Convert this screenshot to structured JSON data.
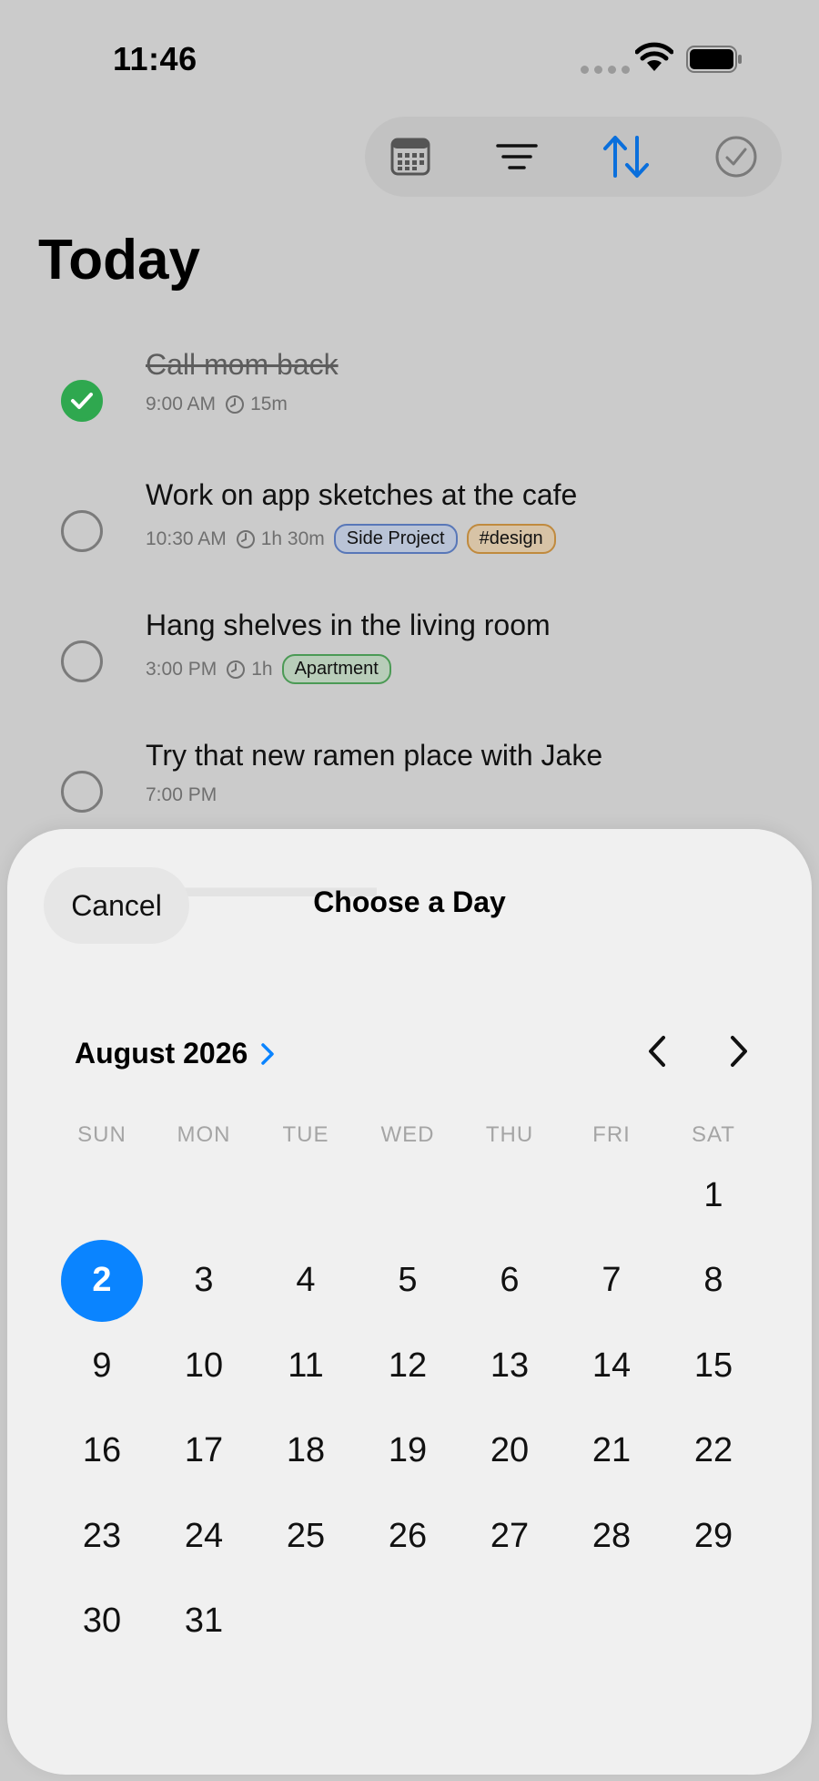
{
  "status_bar": {
    "time": "11:46"
  },
  "toolbar": {
    "buttons": [
      "calendar-icon",
      "filter-icon",
      "sort-icon",
      "checkmark-circle-icon"
    ],
    "accent": "#0a6fdc"
  },
  "page": {
    "title": "Today"
  },
  "tasks": [
    {
      "title": "Call mom back",
      "time": "9:00 AM",
      "duration": "15m",
      "completed": true,
      "tags": []
    },
    {
      "title": "Work on app sketches at the cafe",
      "time": "10:30 AM",
      "duration": "1h 30m",
      "completed": false,
      "tags": [
        {
          "label": "Side Project",
          "color": "blue"
        },
        {
          "label": "#design",
          "color": "orange"
        }
      ]
    },
    {
      "title": "Hang shelves in the living room",
      "time": "3:00 PM",
      "duration": "1h",
      "completed": false,
      "tags": [
        {
          "label": "Apartment",
          "color": "green"
        }
      ]
    },
    {
      "title": "Try that new ramen place with Jake",
      "time": "7:00 PM",
      "duration": "",
      "completed": false,
      "tags": []
    }
  ],
  "sheet": {
    "cancel_label": "Cancel",
    "title": "Choose a Day",
    "month_label": "August 2026",
    "weekdays": [
      "SUN",
      "MON",
      "TUE",
      "WED",
      "THU",
      "FRI",
      "SAT"
    ],
    "first_weekday_index": 6,
    "days_in_month": 31,
    "selected_day": 2,
    "selected_color": "#0a84ff"
  }
}
